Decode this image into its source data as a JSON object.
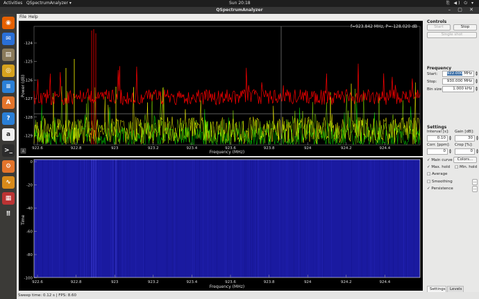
{
  "topbar": {
    "activities": "Activities",
    "app_menu": "QSpectrumAnalyzer ▾",
    "clock": "Sun 20:18",
    "system_icons": "⎘ ◀) ⏻ ▾"
  },
  "window": {
    "title": "QSpectrumAnalyzer",
    "controls": "– ▢ ✕"
  },
  "dock": [
    {
      "icon": "firefox-icon",
      "glyph": "◉",
      "color": "#e66000"
    },
    {
      "icon": "thunderbird-icon",
      "glyph": "✉",
      "color": "#2a6fd6"
    },
    {
      "icon": "files-icon",
      "glyph": "▤",
      "color": "#8a7a5a"
    },
    {
      "icon": "rhythmbox-icon",
      "glyph": "◎",
      "color": "#d6a21e"
    },
    {
      "icon": "writer-icon",
      "glyph": "≡",
      "color": "#2a7fd6"
    },
    {
      "icon": "software-center-icon",
      "glyph": "A",
      "color": "#e3742b"
    },
    {
      "icon": "help-icon",
      "glyph": "?",
      "color": "#2a7fd6"
    },
    {
      "icon": "amazon-icon",
      "glyph": "a",
      "color": "#f0f0f0"
    },
    {
      "icon": "terminal-icon",
      "glyph": ">_",
      "color": "#2c2c2c"
    },
    {
      "icon": "gnuradio-icon",
      "glyph": "⚙",
      "color": "#e3742b"
    },
    {
      "icon": "waveform-icon",
      "glyph": "∿",
      "color": "#d88a1a"
    },
    {
      "icon": "qspectrumanalyzer-icon",
      "glyph": "▦",
      "color": "#b33"
    },
    {
      "icon": "app-grid-icon",
      "glyph": "⠿",
      "color": "#3b3a37"
    }
  ],
  "menu": {
    "file": "File",
    "help": "Help"
  },
  "spectrum": {
    "readout": "f=923.842 MHz, P=-128.020 dB",
    "xlabel": "Frequency (MHz)",
    "ylabel": "Power (dB)",
    "auto_button": "A",
    "x_ticks": [
      "922.6",
      "922.8",
      "923",
      "923.2",
      "923.4",
      "923.6",
      "923.8",
      "924",
      "924.2",
      "924.4"
    ],
    "y_ticks": [
      "-124",
      "-125",
      "-126",
      "-127",
      "-128",
      "-129"
    ],
    "colors": {
      "main_curve": "#ffff00",
      "max_hold": "#ff0000",
      "persistence": "#00c000",
      "background": "#000000"
    }
  },
  "waterfall": {
    "xlabel": "Frequency (MHz)",
    "ylabel": "Time",
    "x_ticks": [
      "922.6",
      "922.8",
      "923",
      "923.2",
      "923.4",
      "923.6",
      "923.8",
      "924",
      "924.2",
      "924.4"
    ],
    "y_ticks": [
      "0",
      "-20",
      "-40",
      "-60",
      "-80",
      "-100"
    ],
    "colors": {
      "fill": "#1a1aa0",
      "border": "#ffffff"
    }
  },
  "sidebar": {
    "controls": {
      "title": "Controls",
      "start": "Start",
      "stop": "Stop",
      "single_shot": "Single shot"
    },
    "frequency": {
      "title": "Frequency",
      "start_label": "Start:",
      "start_value": "922.000",
      "start_unit": "MHz",
      "stop_label": "Stop:",
      "stop_value": "930.000 MHz",
      "bin_label": "Bin size:",
      "bin_value": "1.000 kHz"
    },
    "settings": {
      "title": "Settings",
      "interval_label": "Interval [s]:",
      "interval_value": "0.10",
      "gain_label": "Gain [dB]:",
      "gain_value": "30",
      "corr_label": "Corr. [ppm]:",
      "corr_value": "0",
      "crop_label": "Crop [%]:",
      "crop_value": "0",
      "main_curve": "Main curve",
      "main_curve_checked": "✓",
      "colors_button": "Colors...",
      "max_hold": "Max. hold",
      "max_hold_checked": "✓",
      "min_hold": "Min. hold",
      "average": "Average",
      "smoothing": "Smoothing",
      "smoothing_button": "...",
      "persistence": "Persistence",
      "persistence_checked": "✓",
      "persistence_button": "..."
    },
    "tabs": [
      "Settings",
      "Levels"
    ]
  },
  "status": {
    "text": "Sweep time: 0.12 s | FPS: 8.60"
  }
}
